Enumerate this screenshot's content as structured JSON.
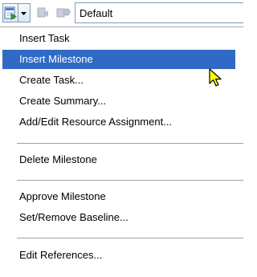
{
  "toolbar": {
    "combo_value": "Default",
    "icons": [
      "task-add-icon",
      "chevron-down-icon",
      "disabled-tool-icon",
      "disabled-tool-icon"
    ]
  },
  "menu": {
    "items": [
      {
        "label": "Insert Task",
        "highlighted": false
      },
      {
        "label": "Insert Milestone",
        "highlighted": true
      },
      {
        "label": "Create Task...",
        "highlighted": false
      },
      {
        "label": "Create Summary...",
        "highlighted": false
      },
      {
        "label": "Add/Edit Resource Assignment...",
        "highlighted": false
      },
      {
        "label": "Delete Milestone",
        "highlighted": false
      },
      {
        "label": "Approve Milestone",
        "highlighted": false
      },
      {
        "label": "Set/Remove Baseline...",
        "highlighted": false
      },
      {
        "label": "Edit References...",
        "highlighted": false
      }
    ]
  },
  "colors": {
    "highlight": "#316ac5",
    "cursor": "#ffff00"
  }
}
